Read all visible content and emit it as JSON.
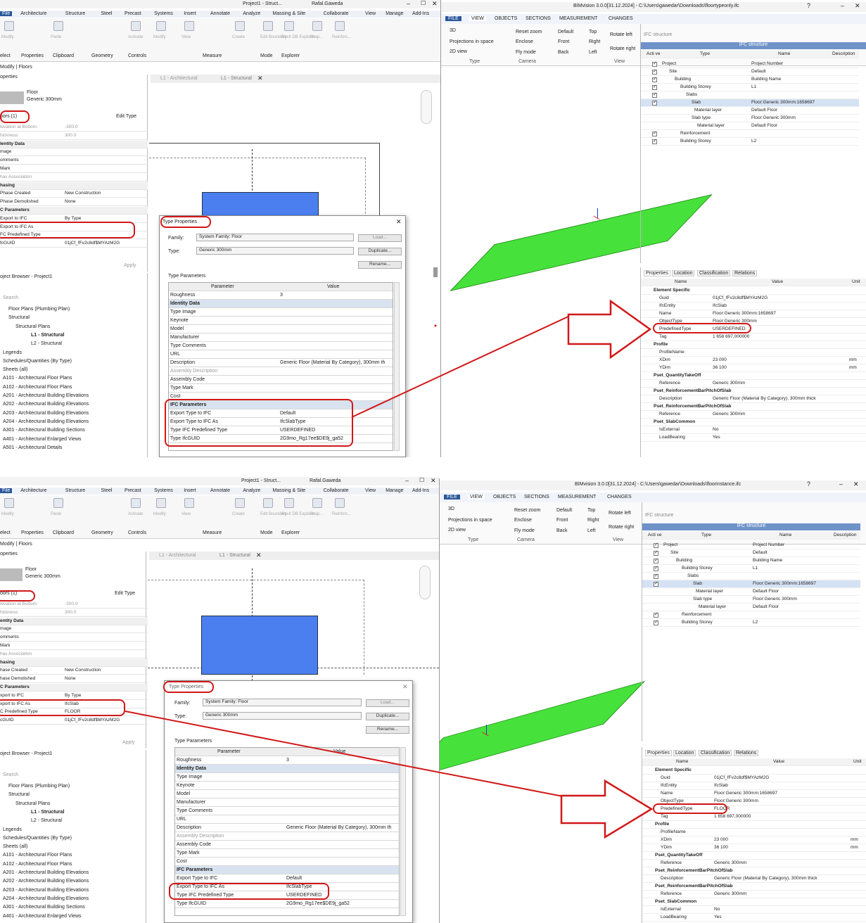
{
  "colors": {
    "accent": "#2b579a",
    "slab": "#46e13a",
    "floor_block": "#4b7ff0",
    "highlight": "#d01818"
  },
  "revit": {
    "title": "Project1 - Struct...",
    "user": "Rafal.Gaweda",
    "menu": [
      "File",
      "Architecture",
      "Structure",
      "Steel",
      "Precast",
      "Systems",
      "Insert",
      "Annotate",
      "Analyze",
      "Massing & Site",
      "Collaborate",
      "View",
      "Manage",
      "Add-Ins",
      "Issues"
    ],
    "ribbon_groups": [
      "elect",
      "Properties",
      "Clipboard",
      "Geometry",
      "Controls",
      "Measure",
      "Mode",
      "Explorer"
    ],
    "ribbon_buttons": [
      "Modify",
      "Paste",
      "Activate",
      "Modify",
      "View",
      "Create",
      "Edit Boundary",
      "Revit DB Explorer",
      "Shap...",
      "Reinforc..."
    ],
    "breadcrumb": "Modify | Floors",
    "properties_title": "operties",
    "type_name": "Floor",
    "type_sub": "Generic 300mm",
    "selector": "oors (1)",
    "edit_type": "Edit Type",
    "apply": "Apply",
    "browser_title": "oject Browser - Project1",
    "search": "Search",
    "tabs": [
      "L1 - Architectural",
      "L1 - Structural"
    ],
    "tree": [
      "Floor Plans (Plumbing Plan)",
      "Structural",
      "Structural Plans",
      "L1 - Structural",
      "L2 - Structural",
      "Legends",
      "Schedules/Quantities (By Type)",
      "Sheets (all)",
      "A101 - Architectural Floor Plans",
      "A102 - Architectural Floor Plans",
      "A201 - Architectural Building Elevations",
      "A202 - Architectural Building Elevations",
      "A203 - Architectural Building Elevations",
      "A204 - Architectural Building Elevations",
      "A301 - Architectural Building Sections",
      "A401 - Architectural Enlarged Views",
      "A501 - Architectural Details"
    ],
    "tree_bottom_last": "A401 - Architectural Enlarged Views"
  },
  "props_top": [
    [
      "levation at Bottom",
      "-300.0"
    ],
    [
      "hickness",
      "300.0"
    ],
    [
      "lentity Data",
      ""
    ],
    [
      "mage",
      ""
    ],
    [
      "omments",
      ""
    ],
    [
      "Mark",
      ""
    ],
    [
      "has Association",
      ""
    ],
    [
      "hasing",
      ""
    ],
    [
      "Phase Created",
      "New Construction"
    ],
    [
      "Phase Demolished",
      "None"
    ],
    [
      "C Parameters",
      ""
    ],
    [
      "Export to IFC",
      "By Type"
    ],
    [
      "Export to IFC As",
      ""
    ],
    [
      "FC Predefined Type",
      ""
    ],
    [
      "fcGUID",
      "01jCf_fFv2c8df$MYAzM2G"
    ]
  ],
  "props_bottom": [
    [
      "levation at Bottom",
      "-300.0"
    ],
    [
      "hickness",
      "300.0"
    ],
    [
      "entity Data",
      ""
    ],
    [
      "mage",
      ""
    ],
    [
      "omments",
      ""
    ],
    [
      "Mark",
      ""
    ],
    [
      "has Association",
      ""
    ],
    [
      "hasing",
      ""
    ],
    [
      "hase Created",
      "New Construction"
    ],
    [
      "hase Demolished",
      "None"
    ],
    [
      "C Parameters",
      ""
    ],
    [
      "xport to IFC",
      "By Type"
    ],
    [
      "xport to IFC As",
      "IfcSlab"
    ],
    [
      "C Predefined Type",
      "FLOOR"
    ],
    [
      "cGUID",
      "01jCf_fFv2c8df$MYAzM2G"
    ]
  ],
  "dialog": {
    "title": "Type Properties",
    "family_label": "Family:",
    "family_value": "System Family: Floor",
    "type_label": "Type:",
    "type_value": "Generic 300mm",
    "load": "Load...",
    "duplicate": "Duplicate...",
    "rename": "Rename...",
    "type_params": "Type Parameters",
    "col_param": "Parameter",
    "col_value": "Value",
    "rows": [
      [
        "Roughness",
        "3"
      ],
      [
        "Identity Data",
        ""
      ],
      [
        "Type Image",
        ""
      ],
      [
        "Keynote",
        ""
      ],
      [
        "Model",
        ""
      ],
      [
        "Manufacturer",
        ""
      ],
      [
        "Type Comments",
        ""
      ],
      [
        "URL",
        ""
      ],
      [
        "Description",
        "Generic Floor (Material By Category), 300mm th"
      ],
      [
        "Assembly Description",
        ""
      ],
      [
        "Assembly Code",
        ""
      ],
      [
        "Type Mark",
        ""
      ],
      [
        "Cost",
        ""
      ],
      [
        "IFC Parameters",
        ""
      ],
      [
        "Export Type to IFC",
        "Default"
      ],
      [
        "Export Type to IFC As",
        "IfcSlabType"
      ],
      [
        "Type IFC Predefined Type",
        "USERDEFINED"
      ],
      [
        "Type IfcGUID",
        "2G9mo_Rg17ee$DE9j_ga52"
      ]
    ]
  },
  "bim_top": {
    "title": "BIMvision 3.0.0[31.12.2024] - C:\\Users\\gawedar\\Downloads\\floortypeonly.ifc"
  },
  "bim_bottom": {
    "title": "BIMvision 3.0.0[31.12.2024] - C:\\Users\\gawedar\\Downloads\\floorinstance.ifc"
  },
  "bim": {
    "tabs": [
      "FILE",
      "VIEW",
      "OBJECTS",
      "SECTIONS",
      "MEASUREMENT",
      "CHANGES"
    ],
    "view_buttons": [
      "3D",
      "Projections in space",
      "2D view",
      "Reset zoom",
      "Enclose",
      "Fly mode",
      "Default",
      "Front",
      "Back",
      "Top",
      "Right",
      "Left",
      "Rotate left",
      "Rotate right"
    ],
    "groups": [
      "Type",
      "Camera",
      "View"
    ],
    "ifc_structure": "IFC structure",
    "tree_cols": [
      "Acti ve",
      "Type",
      "Name",
      "Description"
    ],
    "tree": [
      [
        "Project",
        "Project Number"
      ],
      [
        "Site",
        "Default"
      ],
      [
        "Building",
        "Building Name"
      ],
      [
        "Building Storey",
        "L1"
      ],
      [
        "Slabs",
        ""
      ],
      [
        "Slab",
        "Floor:Generic 300mm:1658697"
      ],
      [
        "Material layer",
        "Default Floor"
      ],
      [
        "Slab type",
        "Floor:Generic 300mm"
      ],
      [
        "Material layer",
        "Default Floor"
      ],
      [
        "Reinforcement",
        ""
      ],
      [
        "Building Storey",
        "L2"
      ]
    ],
    "prop_tabs": [
      "Properties",
      "Location",
      "Classification",
      "Relations"
    ],
    "prop_cols": [
      "Name",
      "Value",
      "Unit"
    ]
  },
  "bim_props_top": [
    [
      "Element Specific",
      "",
      ""
    ],
    [
      "Guid",
      "01jCf_fFv2c8df$MYAzM2G",
      ""
    ],
    [
      "IfcEntity",
      "IfcSlab",
      ""
    ],
    [
      "Name",
      "Floor:Generic 300mm:1658697",
      ""
    ],
    [
      "ObjectType",
      "Floor:Generic 300mm",
      ""
    ],
    [
      "PredefinedType",
      "USERDEFINED",
      ""
    ],
    [
      "Tag",
      "1 658 697,000000",
      ""
    ],
    [
      "Profile",
      "",
      ""
    ],
    [
      "ProfileName",
      "",
      ""
    ],
    [
      "XDim",
      "23 000",
      "mm"
    ],
    [
      "YDim",
      "36 100",
      "mm"
    ],
    [
      "Pset_QuantityTakeOff",
      "",
      ""
    ],
    [
      "Reference",
      "Generic 300mm",
      ""
    ],
    [
      "Pset_ReinforcementBarPitchOfSlab",
      "",
      ""
    ],
    [
      "Description",
      "Generic Floor (Material By Category), 300mm thick",
      ""
    ],
    [
      "Pset_ReinforcementBarPitchOfSlab",
      "",
      ""
    ],
    [
      "Reference",
      "Generic 300mm",
      ""
    ],
    [
      "Pset_SlabCommon",
      "",
      ""
    ],
    [
      "IsExternal",
      "No",
      ""
    ],
    [
      "LoadBearing",
      "Yes",
      ""
    ]
  ],
  "bim_props_bottom": [
    [
      "Element Specific",
      "",
      ""
    ],
    [
      "Guid",
      "01jCf_fFv2c8df$MYAzM2G",
      ""
    ],
    [
      "IfcEntity",
      "IfcSlab",
      ""
    ],
    [
      "Name",
      "Floor:Generic 300mm:1658697",
      ""
    ],
    [
      "ObjectType",
      "Floor:Generic 300mm",
      ""
    ],
    [
      "PredefinedType",
      "FLOOR",
      ""
    ],
    [
      "Tag",
      "1 658 697,000000",
      ""
    ],
    [
      "Profile",
      "",
      ""
    ],
    [
      "ProfileName",
      "",
      ""
    ],
    [
      "XDim",
      "23 000",
      "mm"
    ],
    [
      "YDim",
      "36 100",
      "mm"
    ],
    [
      "Pset_QuantityTakeOff",
      "",
      ""
    ],
    [
      "Reference",
      "Generic 300mm",
      ""
    ],
    [
      "Pset_ReinforcementBarPitchOfSlab",
      "",
      ""
    ],
    [
      "Description",
      "Generic Floor (Material By Category), 300mm thick",
      ""
    ],
    [
      "Pset_ReinforcementBarPitchOfSlab",
      "",
      ""
    ],
    [
      "Reference",
      "Generic 300mm",
      ""
    ],
    [
      "Pset_SlabCommon",
      "",
      ""
    ],
    [
      "IsExternal",
      "No",
      ""
    ],
    [
      "LoadBearing",
      "Yes",
      ""
    ]
  ]
}
